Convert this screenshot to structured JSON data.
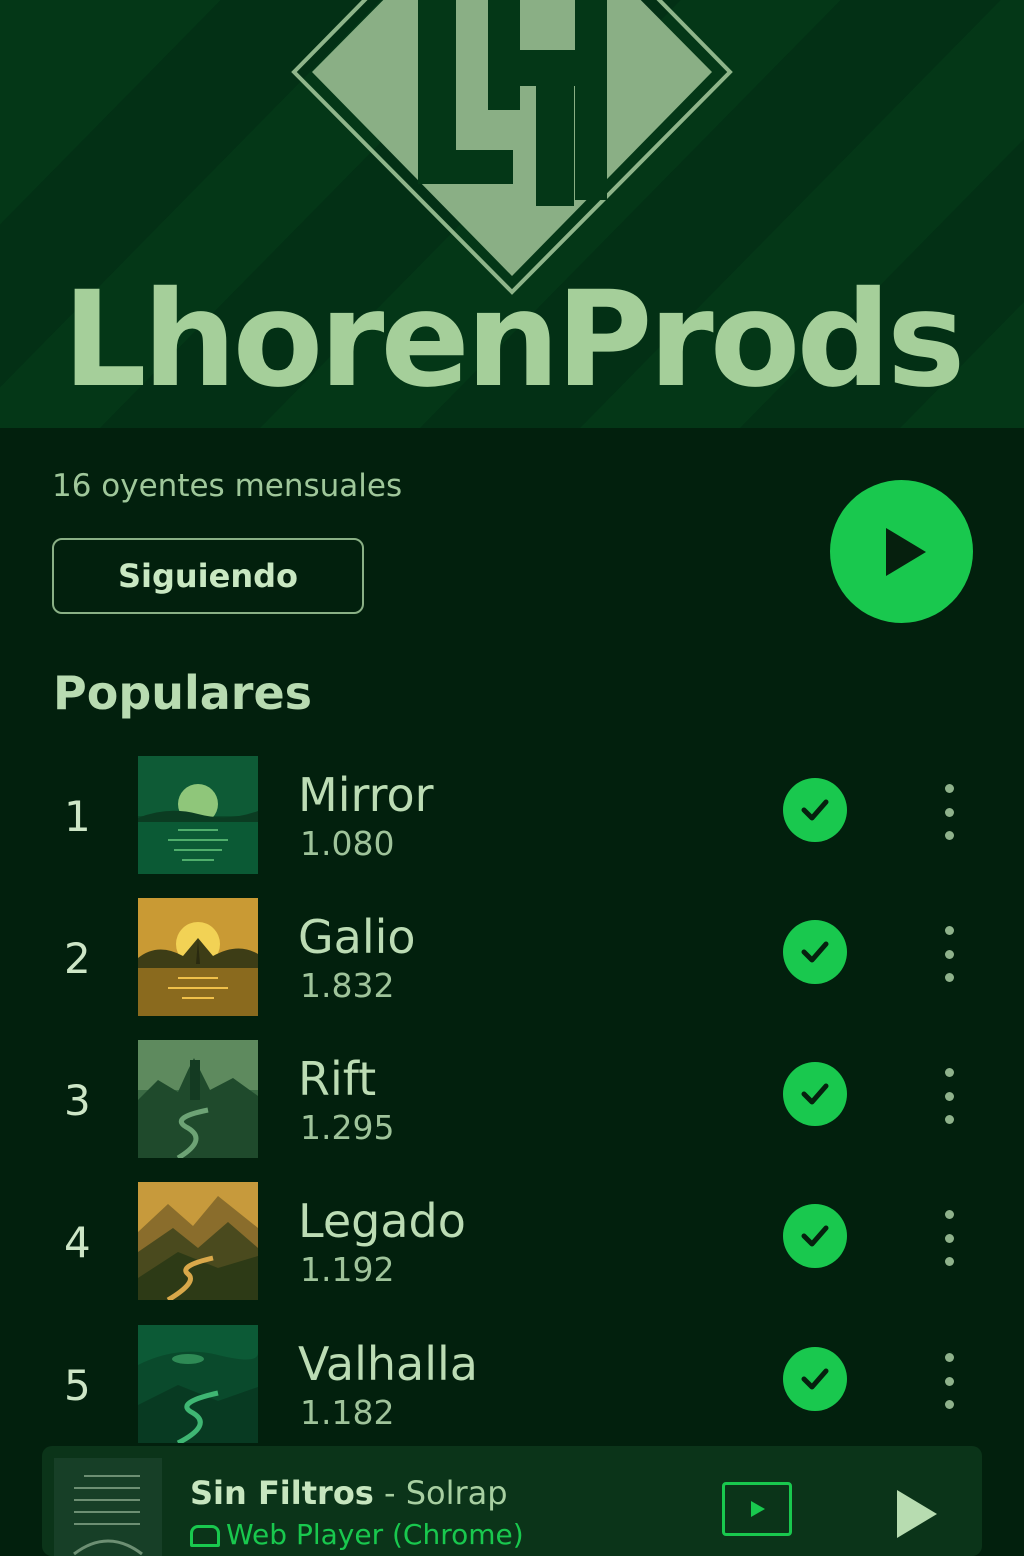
{
  "artist": {
    "name": "LhorenProds",
    "logo_letters": "LH",
    "monthly_listeners": "16 oyentes mensuales",
    "follow_label": "Siguiendo"
  },
  "colors": {
    "accent": "#19c84e",
    "background": "#02200d",
    "hero_background": "#043717",
    "text": "#b7dcb0"
  },
  "popular": {
    "title": "Populares",
    "tracks": [
      {
        "num": "1",
        "title": "Mirror",
        "plays": "1.080",
        "art": "moon-lake"
      },
      {
        "num": "2",
        "title": "Galio",
        "plays": "1.832",
        "art": "golden-sunset"
      },
      {
        "num": "3",
        "title": "Rift",
        "plays": "1.295",
        "art": "tower-river"
      },
      {
        "num": "4",
        "title": "Legado",
        "plays": "1.192",
        "art": "golden-valley"
      },
      {
        "num": "5",
        "title": "Valhalla",
        "plays": "1.182",
        "art": "green-river"
      }
    ]
  },
  "now_playing": {
    "song": "Sin Filtros",
    "separator": " - ",
    "artist": "Solrap",
    "device": "Web Player (Chrome)"
  },
  "icons": {
    "big_play": "play-icon",
    "downloaded": "check-icon",
    "more": "more-vertical-icon",
    "connect": "connect-device-icon",
    "mini_play": "play-icon"
  }
}
